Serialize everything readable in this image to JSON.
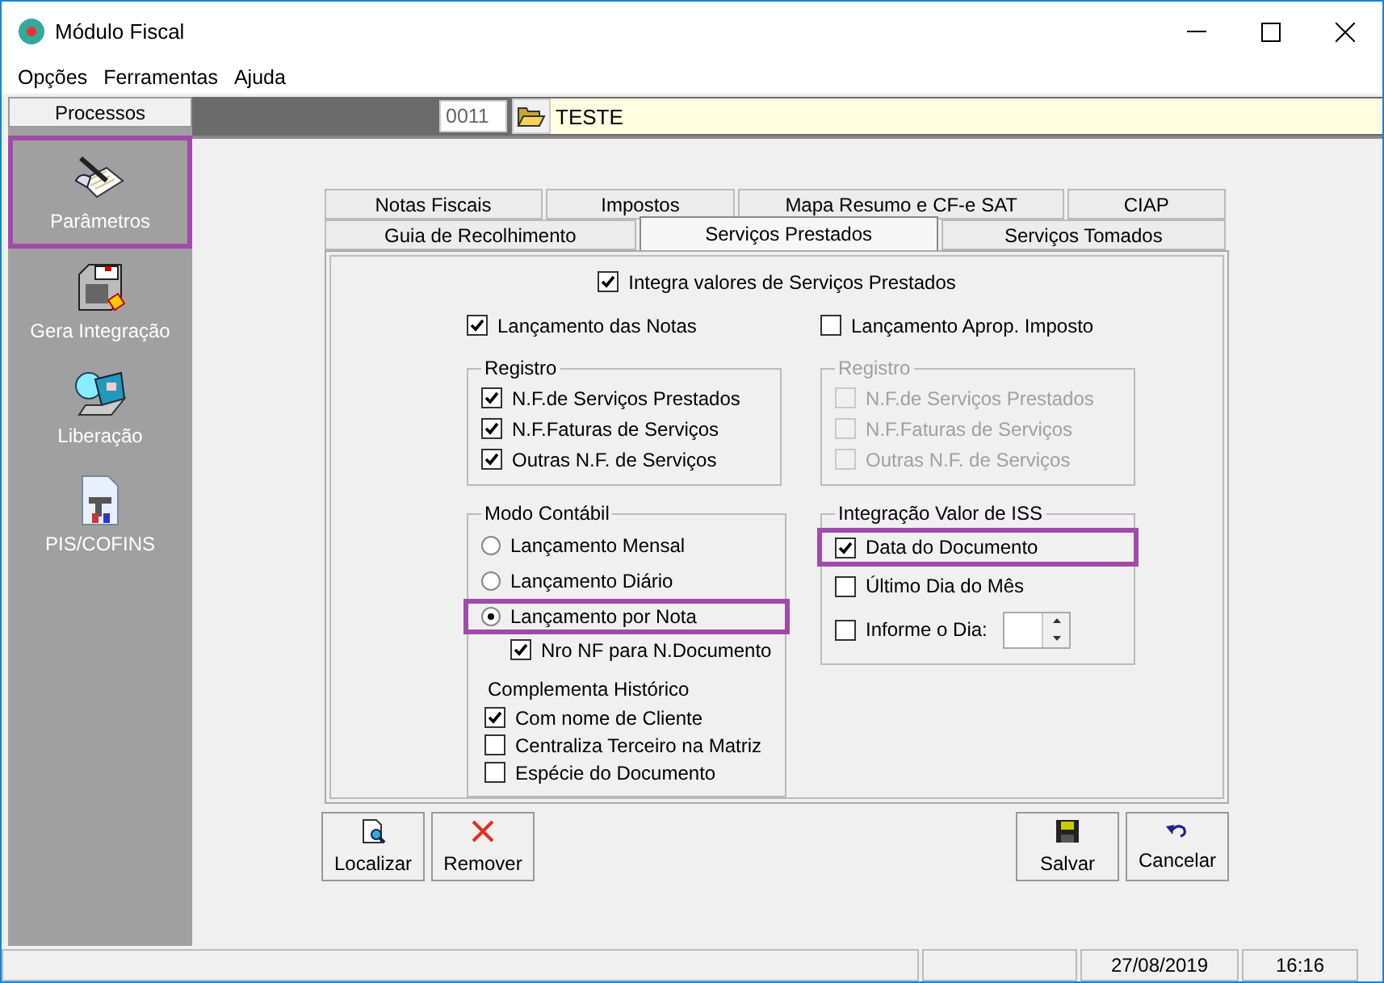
{
  "window": {
    "title": "Módulo Fiscal"
  },
  "menu": [
    "Opções",
    "Ferramentas",
    "Ajuda"
  ],
  "sidebar": {
    "header": "Processos",
    "items": [
      {
        "label": "Parâmetros",
        "highlighted": true
      },
      {
        "label": "Gera Integração",
        "highlighted": false
      },
      {
        "label": "Liberação",
        "highlighted": false
      },
      {
        "label": "PIS/COFINS",
        "highlighted": false
      }
    ]
  },
  "company": {
    "code": "0011",
    "name": "TESTE"
  },
  "tabs": [
    [
      {
        "label": "Notas Fiscais",
        "selected": false
      },
      {
        "label": "Impostos",
        "selected": false
      },
      {
        "label": "Mapa Resumo e CF-e SAT",
        "selected": false
      },
      {
        "label": "CIAP",
        "selected": false
      }
    ],
    [
      {
        "label": "Guia de Recolhimento",
        "selected": false
      },
      {
        "label": "Serviços Prestados",
        "selected": true
      },
      {
        "label": "Serviços Tomados",
        "selected": false
      }
    ]
  ],
  "form": {
    "integra": {
      "label": "Integra valores de Serviços Prestados",
      "checked": true
    },
    "left": {
      "main": {
        "label": "Lançamento das Notas",
        "checked": true
      },
      "registro": {
        "title": "Registro",
        "disabled": false,
        "items": [
          {
            "label": "N.F.de Serviços Prestados",
            "checked": true
          },
          {
            "label": "N.F.Faturas de Serviços",
            "checked": true
          },
          {
            "label": "Outras N.F. de Serviços",
            "checked": true
          }
        ]
      }
    },
    "right": {
      "main": {
        "label": "Lançamento Aprop. Imposto",
        "checked": false
      },
      "registro": {
        "title": "Registro",
        "disabled": true,
        "items": [
          {
            "label": "N.F.de Serviços Prestados",
            "checked": false
          },
          {
            "label": "N.F.Faturas de Serviços",
            "checked": false
          },
          {
            "label": "Outras N.F. de Serviços",
            "checked": false
          }
        ]
      }
    },
    "modo": {
      "title": "Modo Contábil",
      "options": [
        {
          "label": "Lançamento Mensal",
          "selected": false,
          "highlighted": false
        },
        {
          "label": "Lançamento Diário",
          "selected": false,
          "highlighted": false
        },
        {
          "label": "Lançamento por Nota",
          "selected": true,
          "highlighted": true
        }
      ],
      "sub": {
        "label": "Nro NF para N.Documento",
        "checked": true
      },
      "historico": {
        "title": "Complementa Histórico",
        "items": [
          {
            "label": "Com nome de Cliente",
            "checked": true
          },
          {
            "label": "Centraliza Terceiro na Matriz",
            "checked": false
          },
          {
            "label": "Espécie do Documento",
            "checked": false
          }
        ]
      }
    },
    "iss": {
      "title": "Integração Valor de ISS",
      "items": [
        {
          "label": "Data do Documento",
          "checked": true,
          "highlighted": true,
          "kind": "check"
        },
        {
          "label": "Último Dia do Mês",
          "checked": false,
          "highlighted": false,
          "kind": "check"
        },
        {
          "label": "Informe o Dia:",
          "checked": false,
          "highlighted": false,
          "kind": "spin"
        }
      ]
    }
  },
  "buttons_left": [
    "Localizar",
    "Remover"
  ],
  "buttons_right": [
    "Salvar",
    "Cancelar"
  ],
  "status_bar": {
    "date": "27/08/2019",
    "time": "16:16"
  }
}
